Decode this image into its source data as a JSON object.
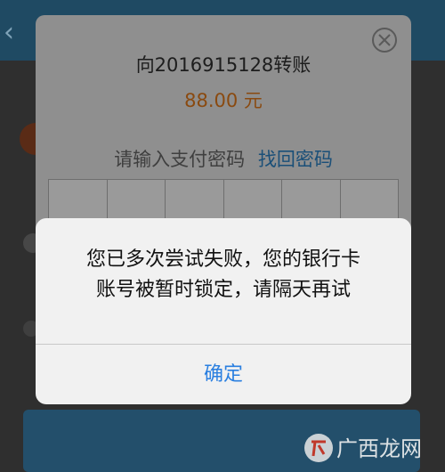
{
  "payment": {
    "title": "向2016915128转账",
    "amount": "88.00 元",
    "password_prompt": "请输入支付密码",
    "forgot_link": "找回密码",
    "digit_cells": 6
  },
  "alert": {
    "message_line1": "您已多次尝试失败，您的银行卡",
    "message_line2": "账号被暂时锁定，请隔天再试",
    "confirm_label": "确定"
  },
  "watermark": {
    "text": "广西龙网"
  },
  "colors": {
    "overlay_dim": "#2f2f2f",
    "header": "#1f4a63",
    "amount": "#b8671a",
    "link": "#1a4f78",
    "confirm": "#2a7fe0",
    "alert_bg": "#f1f1f1"
  },
  "icons": {
    "close": "close-circle-icon",
    "back": "back-arrow-icon",
    "logo": "watermark-logo"
  }
}
